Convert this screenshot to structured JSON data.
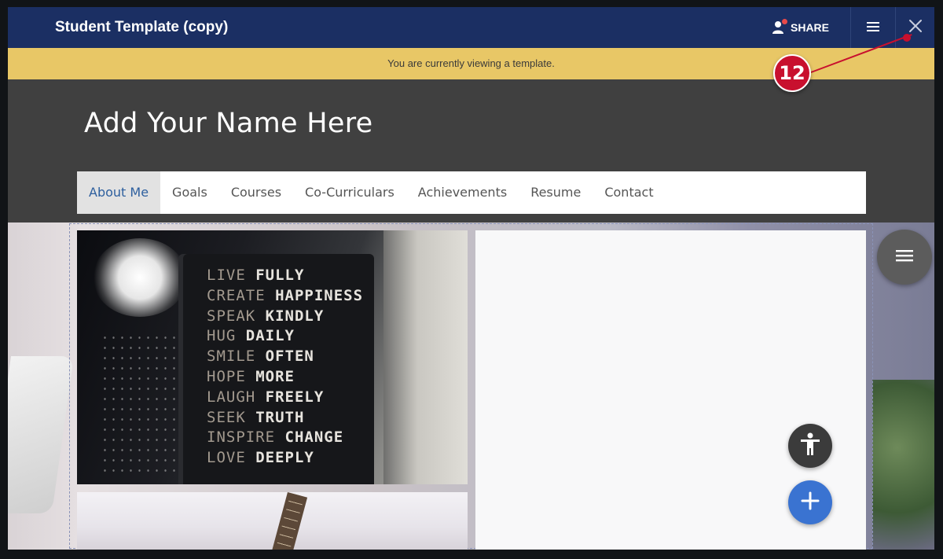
{
  "app": {
    "title": "Student Template (copy)",
    "share_label": "SHARE",
    "menu_icon": "hamburger-menu-icon",
    "close_icon": "close-icon",
    "colors": {
      "topbar": "#1b2f63",
      "banner": "#e8c766",
      "header": "#404040",
      "accent": "#3a73d1"
    }
  },
  "banner": {
    "text": "You are currently viewing a template."
  },
  "site": {
    "name": "Add Your Name Here",
    "nav": [
      {
        "label": "About Me",
        "active": true
      },
      {
        "label": "Goals",
        "active": false
      },
      {
        "label": "Courses",
        "active": false
      },
      {
        "label": "Co-Curriculars",
        "active": false
      },
      {
        "label": "Achievements",
        "active": false
      },
      {
        "label": "Resume",
        "active": false
      },
      {
        "label": "Contact",
        "active": false
      }
    ]
  },
  "quote_image": {
    "lines": [
      [
        "LIVE",
        "FULLY"
      ],
      [
        "CREATE",
        "HAPPINESS"
      ],
      [
        "SPEAK",
        "KINDLY"
      ],
      [
        "HUG",
        "DAILY"
      ],
      [
        "SMILE",
        "OFTEN"
      ],
      [
        "HOPE",
        "MORE"
      ],
      [
        "LAUGH",
        "FREELY"
      ],
      [
        "SEEK",
        "TRUTH"
      ],
      [
        "INSPIRE",
        "CHANGE"
      ],
      [
        "LOVE",
        "DEEPLY"
      ]
    ]
  },
  "floating": {
    "menu_icon": "hamburger-menu-icon",
    "accessibility_icon": "accessibility-icon",
    "add_icon": "plus-icon"
  },
  "annotation": {
    "callout_number": "12"
  }
}
